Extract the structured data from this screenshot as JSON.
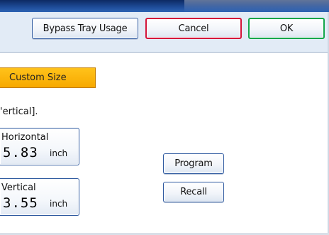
{
  "header": {
    "bypass_label": "Bypass Tray Usage",
    "cancel_label": "Cancel",
    "ok_label": "OK"
  },
  "custom_size_label": "Custom Size",
  "instruction_text": "'ertical].",
  "horizontal": {
    "label": "Horizontal",
    "value": "5.83",
    "unit": "inch"
  },
  "vertical": {
    "label": "Vertical",
    "value": "3.55",
    "unit": "inch"
  },
  "program_label": "Program",
  "recall_label": "Recall",
  "colors": {
    "cancel_border": "#d4143a",
    "ok_border": "#13a64a",
    "custom_size_fill": "#f7a900",
    "button_border": "#2f5aa0"
  }
}
